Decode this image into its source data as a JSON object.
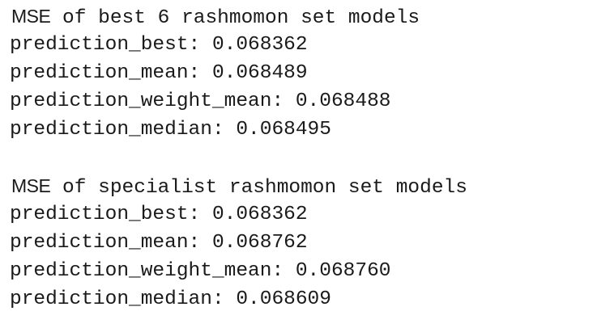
{
  "output": {
    "sections": [
      {
        "heading_prefix": "MSE",
        "heading_rest": " of best 6 rashmomon set models",
        "lines": [
          "prediction_best: 0.068362",
          "prediction_mean: 0.068489",
          "prediction_weight_mean: 0.068488",
          "prediction_median: 0.068495"
        ]
      },
      {
        "heading_prefix": "MSE",
        "heading_rest": " of specialist rashmomon set models",
        "lines": [
          "prediction_best: 0.068362",
          "prediction_mean: 0.068762",
          "prediction_weight_mean: 0.068760",
          "prediction_median: 0.068609"
        ]
      }
    ]
  }
}
